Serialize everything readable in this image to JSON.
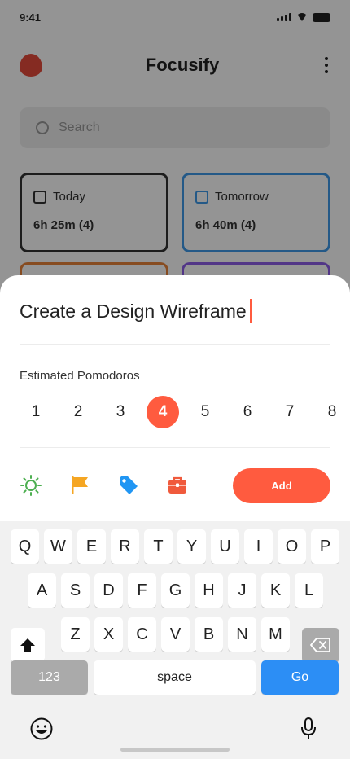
{
  "status_bar": {
    "time": "9:41"
  },
  "app": {
    "title": "Focusify",
    "search_placeholder": "Search",
    "cards": [
      {
        "label": "Today",
        "value": "6h 25m (4)"
      },
      {
        "label": "Tomorrow",
        "value": "6h 40m (4)"
      }
    ]
  },
  "sheet": {
    "task_title": "Create a Design Wireframe",
    "pomodoro_label": "Estimated Pomodoros",
    "pomodoros": [
      "1",
      "2",
      "3",
      "4",
      "5",
      "6",
      "7",
      "8"
    ],
    "selected_pomodoro": "4",
    "icons": [
      "sun-icon",
      "flag-icon",
      "tag-icon",
      "briefcase-icon"
    ],
    "add_label": "Add"
  },
  "keyboard": {
    "row1": [
      "Q",
      "W",
      "E",
      "R",
      "T",
      "Y",
      "U",
      "I",
      "O",
      "P"
    ],
    "row2": [
      "A",
      "S",
      "D",
      "F",
      "G",
      "H",
      "J",
      "K",
      "L"
    ],
    "row3": [
      "Z",
      "X",
      "C",
      "V",
      "B",
      "N",
      "M"
    ],
    "numbers_label": "123",
    "space_label": "space",
    "go_label": "Go"
  },
  "colors": {
    "accent": "#ff5b3f",
    "go": "#2c8ef5",
    "sun": "#4caf50",
    "flag": "#f5a623",
    "tag": "#2196f3",
    "briefcase": "#f05a3c"
  }
}
